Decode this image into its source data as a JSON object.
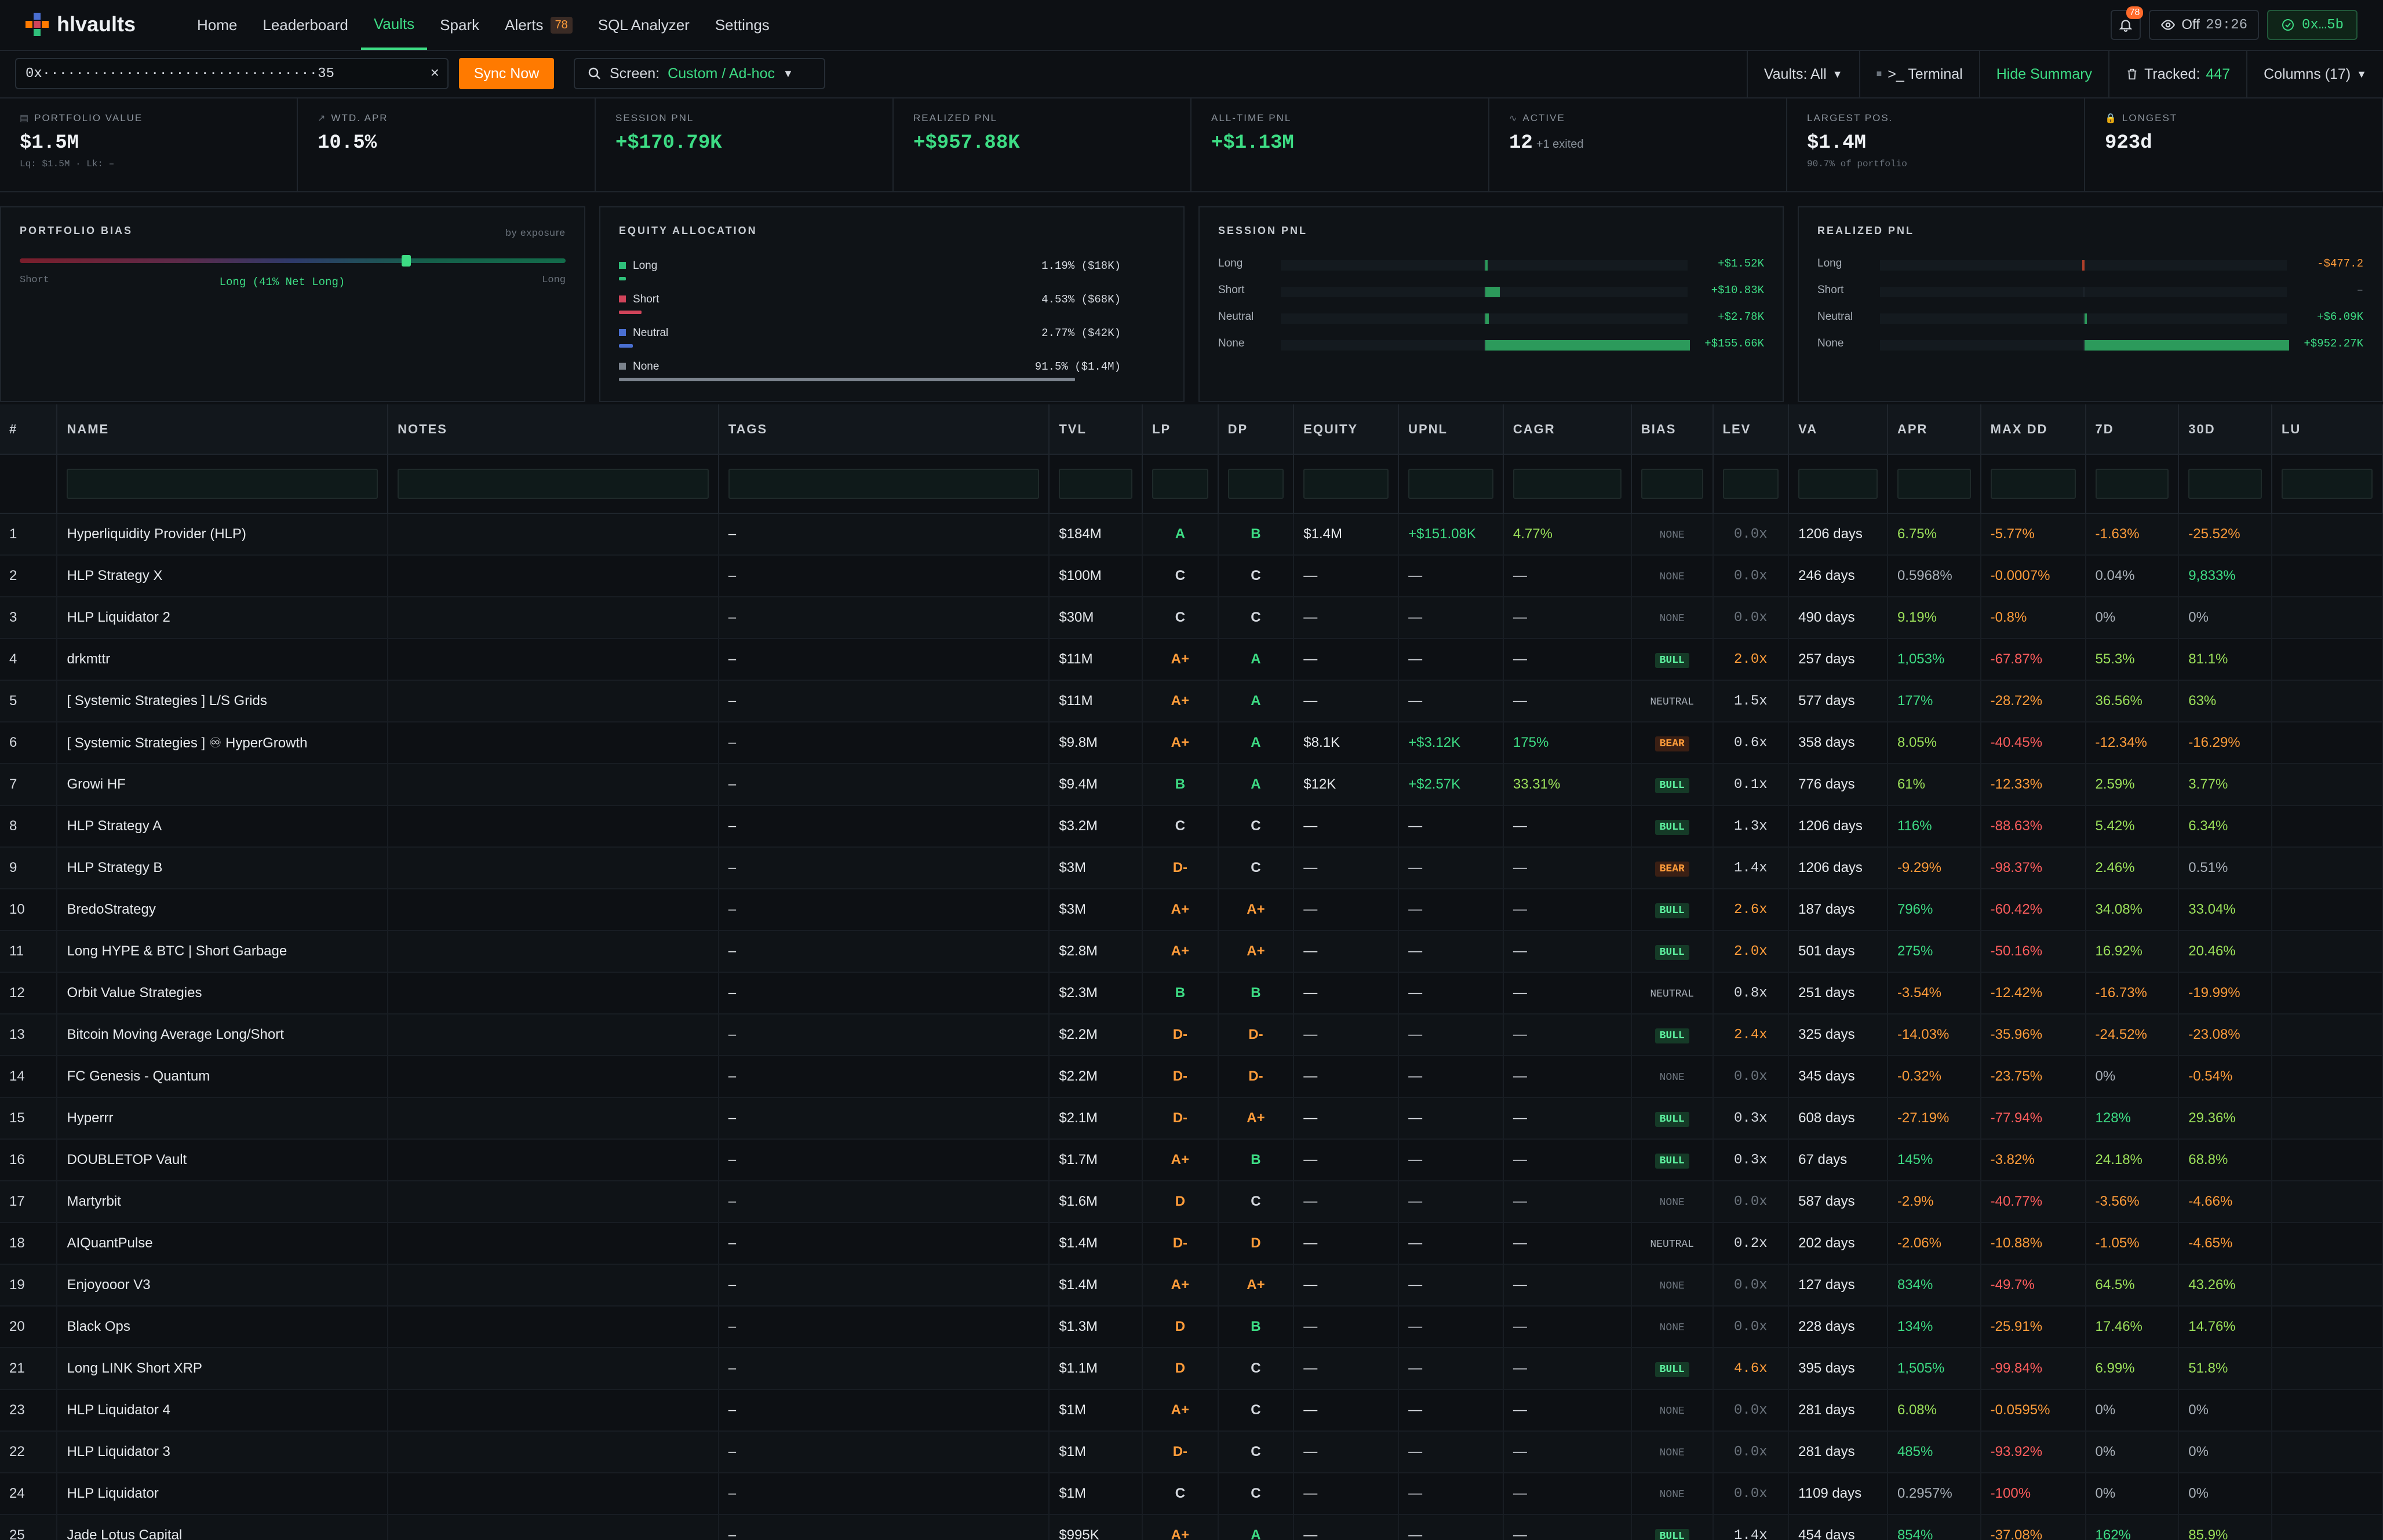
{
  "app": {
    "name": "hlvaults"
  },
  "nav": [
    {
      "label": "Home",
      "active": false
    },
    {
      "label": "Leaderboard",
      "active": false
    },
    {
      "label": "Vaults",
      "active": true
    },
    {
      "label": "Spark",
      "active": false
    },
    {
      "label": "Alerts",
      "active": false,
      "badge": "78"
    },
    {
      "label": "SQL Analyzer",
      "active": false
    },
    {
      "label": "Settings",
      "active": false
    }
  ],
  "topRight": {
    "bell_badge": "78",
    "live_status": "Off",
    "timer": "29:26",
    "wallet": "0x…5b"
  },
  "toolbar": {
    "address_value": "0x·································35",
    "clear": "×",
    "sync_label": "Sync Now",
    "screen_label": "Screen:",
    "screen_value": "Custom / Ad-hoc",
    "vaults_label": "Vaults: All",
    "terminal_label": ">_ Terminal",
    "hide_summary_label": "Hide Summary",
    "tracked_label": "Tracked:",
    "tracked_value": "447",
    "columns_label": "Columns (17)"
  },
  "summary": [
    {
      "label": "PORTFOLIO VALUE",
      "value": "$1.5M",
      "sub": "Lq: $1.5M · Lk: –",
      "color": "#eef1f4"
    },
    {
      "label": "WTD. APR",
      "value": "10.5%",
      "sub": "",
      "color": "#eef1f4"
    },
    {
      "label": "SESSION PNL",
      "value": "+$170.79K",
      "sub": "",
      "color": "#3ddc84"
    },
    {
      "label": "REALIZED PNL",
      "value": "+$957.88K",
      "sub": "",
      "color": "#3ddc84"
    },
    {
      "label": "ALL-TIME PNL",
      "value": "+$1.13M",
      "sub": "",
      "color": "#3ddc84"
    },
    {
      "label": "ACTIVE",
      "value": "12",
      "extra": "+1 exited",
      "sub": "",
      "color": "#eef1f4"
    },
    {
      "label": "LARGEST POS.",
      "value": "$1.4M",
      "sub": "90.7% of portfolio",
      "color": "#eef1f4"
    },
    {
      "label": "LONGEST",
      "value": "923d",
      "sub": "",
      "color": "#eef1f4"
    }
  ],
  "bias": {
    "title": "PORTFOLIO BIAS",
    "sub": "by exposure",
    "left": "Short",
    "right": "Long",
    "center": "Long (41% Net Long)",
    "position": 0.705
  },
  "allocation": {
    "title": "EQUITY ALLOCATION",
    "rows": [
      {
        "name": "Long",
        "value": "1.19% ($18K)",
        "color": "#2fbf7a",
        "fraction": 0.0119
      },
      {
        "name": "Short",
        "value": "4.53% ($68K)",
        "color": "#d0445a",
        "fraction": 0.0453
      },
      {
        "name": "Neutral",
        "value": "2.77% ($42K)",
        "color": "#4a6fd1",
        "fraction": 0.0277
      },
      {
        "name": "None",
        "value": "91.5% ($1.4M)",
        "color": "#7b838d",
        "fraction": 0.915
      }
    ]
  },
  "sessionPnl": {
    "title": "SESSION PNL",
    "rows": [
      {
        "name": "Long",
        "value": "+$1.52K",
        "amount": 1520
      },
      {
        "name": "Short",
        "value": "+$10.83K",
        "amount": 10830
      },
      {
        "name": "Neutral",
        "value": "+$2.78K",
        "amount": 2780
      },
      {
        "name": "None",
        "value": "+$155.66K",
        "amount": 155660
      }
    ]
  },
  "realizedPnl": {
    "title": "REALIZED PNL",
    "rows": [
      {
        "name": "Long",
        "value": "-$477.2",
        "amount": -477.2
      },
      {
        "name": "Short",
        "value": "–",
        "amount": 0
      },
      {
        "name": "Neutral",
        "value": "+$6.09K",
        "amount": 6090
      },
      {
        "name": "None",
        "value": "+$952.27K",
        "amount": 952270
      }
    ]
  },
  "table": {
    "columns": [
      "#",
      "NAME",
      "NOTES",
      "TAGS",
      "TVL",
      "LP",
      "DP",
      "EQUITY",
      "UPNL",
      "CAGR",
      "BIAS",
      "LEV",
      "VA",
      "APR",
      "MAX DD",
      "7D",
      "30D",
      "LU"
    ],
    "rows": [
      [
        "1",
        "Hyperliquidity Provider (HLP)",
        "",
        "–",
        "$184M",
        "A",
        "B",
        "$1.4M",
        "+$151.08K",
        "4.77%",
        "NONE",
        "0.0x",
        "1206 days",
        "6.75%",
        "-5.77%",
        "-1.63%",
        "-25.52%",
        ""
      ],
      [
        "2",
        "HLP Strategy X",
        "",
        "–",
        "$100M",
        "C",
        "C",
        "—",
        "—",
        "—",
        "NONE",
        "0.0x",
        "246 days",
        "0.5968%",
        "-0.0007%",
        "0.04%",
        "9,833%",
        ""
      ],
      [
        "3",
        "HLP Liquidator 2",
        "",
        "–",
        "$30M",
        "C",
        "C",
        "—",
        "—",
        "—",
        "NONE",
        "0.0x",
        "490 days",
        "9.19%",
        "-0.8%",
        "0%",
        "0%",
        ""
      ],
      [
        "4",
        "drkmttr",
        "",
        "–",
        "$11M",
        "A+",
        "A",
        "—",
        "—",
        "—",
        "BULL",
        "2.0x",
        "257 days",
        "1,053%",
        "-67.87%",
        "55.3%",
        "81.1%",
        ""
      ],
      [
        "5",
        "[ Systemic Strategies ] L/S Grids",
        "",
        "–",
        "$11M",
        "A+",
        "A",
        "—",
        "—",
        "—",
        "NEUTRAL",
        "1.5x",
        "577 days",
        "177%",
        "-28.72%",
        "36.56%",
        "63%",
        ""
      ],
      [
        "6",
        "[ Systemic Strategies ] ♾ HyperGrowth",
        "",
        "–",
        "$9.8M",
        "A+",
        "A",
        "$8.1K",
        "+$3.12K",
        "175%",
        "BEAR",
        "0.6x",
        "358 days",
        "8.05%",
        "-40.45%",
        "-12.34%",
        "-16.29%",
        ""
      ],
      [
        "7",
        "Growi HF",
        "",
        "–",
        "$9.4M",
        "B",
        "A",
        "$12K",
        "+$2.57K",
        "33.31%",
        "BULL",
        "0.1x",
        "776 days",
        "61%",
        "-12.33%",
        "2.59%",
        "3.77%",
        ""
      ],
      [
        "8",
        "HLP Strategy A",
        "",
        "–",
        "$3.2M",
        "C",
        "C",
        "—",
        "—",
        "—",
        "BULL",
        "1.3x",
        "1206 days",
        "116%",
        "-88.63%",
        "5.42%",
        "6.34%",
        ""
      ],
      [
        "9",
        "HLP Strategy B",
        "",
        "–",
        "$3M",
        "D-",
        "C",
        "—",
        "—",
        "—",
        "BEAR",
        "1.4x",
        "1206 days",
        "-9.29%",
        "-98.37%",
        "2.46%",
        "0.51%",
        ""
      ],
      [
        "10",
        "BredoStrategy",
        "",
        "–",
        "$3M",
        "A+",
        "A+",
        "—",
        "—",
        "—",
        "BULL",
        "2.6x",
        "187 days",
        "796%",
        "-60.42%",
        "34.08%",
        "33.04%",
        ""
      ],
      [
        "11",
        "Long HYPE & BTC | Short Garbage",
        "",
        "–",
        "$2.8M",
        "A+",
        "A+",
        "—",
        "—",
        "—",
        "BULL",
        "2.0x",
        "501 days",
        "275%",
        "-50.16%",
        "16.92%",
        "20.46%",
        ""
      ],
      [
        "12",
        "Orbit Value Strategies",
        "",
        "–",
        "$2.3M",
        "B",
        "B",
        "—",
        "—",
        "—",
        "NEUTRAL",
        "0.8x",
        "251 days",
        "-3.54%",
        "-12.42%",
        "-16.73%",
        "-19.99%",
        ""
      ],
      [
        "13",
        "Bitcoin Moving Average Long/Short",
        "",
        "–",
        "$2.2M",
        "D-",
        "D-",
        "—",
        "—",
        "—",
        "BULL",
        "2.4x",
        "325 days",
        "-14.03%",
        "-35.96%",
        "-24.52%",
        "-23.08%",
        ""
      ],
      [
        "14",
        "FC Genesis - Quantum",
        "",
        "–",
        "$2.2M",
        "D-",
        "D-",
        "—",
        "—",
        "—",
        "NONE",
        "0.0x",
        "345 days",
        "-0.32%",
        "-23.75%",
        "0%",
        "-0.54%",
        ""
      ],
      [
        "15",
        "Hyperrr",
        "",
        "–",
        "$2.1M",
        "D-",
        "A+",
        "—",
        "—",
        "—",
        "BULL",
        "0.3x",
        "608 days",
        "-27.19%",
        "-77.94%",
        "128%",
        "29.36%",
        ""
      ],
      [
        "16",
        "DOUBLETOP Vault",
        "",
        "–",
        "$1.7M",
        "A+",
        "B",
        "—",
        "—",
        "—",
        "BULL",
        "0.3x",
        "67 days",
        "145%",
        "-3.82%",
        "24.18%",
        "68.8%",
        ""
      ],
      [
        "17",
        "Martyrbit",
        "",
        "–",
        "$1.6M",
        "D",
        "C",
        "—",
        "—",
        "—",
        "NONE",
        "0.0x",
        "587 days",
        "-2.9%",
        "-40.77%",
        "-3.56%",
        "-4.66%",
        ""
      ],
      [
        "18",
        "AIQuantPulse",
        "",
        "–",
        "$1.4M",
        "D-",
        "D",
        "—",
        "—",
        "—",
        "NEUTRAL",
        "0.2x",
        "202 days",
        "-2.06%",
        "-10.88%",
        "-1.05%",
        "-4.65%",
        ""
      ],
      [
        "19",
        "Enjoyooor V3",
        "",
        "–",
        "$1.4M",
        "A+",
        "A+",
        "—",
        "—",
        "—",
        "NONE",
        "0.0x",
        "127 days",
        "834%",
        "-49.7%",
        "64.5%",
        "43.26%",
        ""
      ],
      [
        "20",
        "Black Ops",
        "",
        "–",
        "$1.3M",
        "D",
        "B",
        "—",
        "—",
        "—",
        "NONE",
        "0.0x",
        "228 days",
        "134%",
        "-25.91%",
        "17.46%",
        "14.76%",
        ""
      ],
      [
        "21",
        "Long LINK Short XRP",
        "",
        "–",
        "$1.1M",
        "D",
        "C",
        "—",
        "—",
        "—",
        "BULL",
        "4.6x",
        "395 days",
        "1,505%",
        "-99.84%",
        "6.99%",
        "51.8%",
        ""
      ],
      [
        "23",
        "HLP Liquidator 4",
        "",
        "–",
        "$1M",
        "A+",
        "C",
        "—",
        "—",
        "—",
        "NONE",
        "0.0x",
        "281 days",
        "6.08%",
        "-0.0595%",
        "0%",
        "0%",
        ""
      ],
      [
        "22",
        "HLP Liquidator 3",
        "",
        "–",
        "$1M",
        "D-",
        "C",
        "—",
        "—",
        "—",
        "NONE",
        "0.0x",
        "281 days",
        "485%",
        "-93.92%",
        "0%",
        "0%",
        ""
      ],
      [
        "24",
        "HLP Liquidator",
        "",
        "–",
        "$1M",
        "C",
        "C",
        "—",
        "—",
        "—",
        "NONE",
        "0.0x",
        "1109 days",
        "0.2957%",
        "-100%",
        "0%",
        "0%",
        ""
      ],
      [
        "25",
        "Jade Lotus Capital",
        "",
        "–",
        "$995K",
        "A+",
        "A",
        "—",
        "—",
        "—",
        "BULL",
        "1.4x",
        "454 days",
        "854%",
        "-37.08%",
        "162%",
        "85.9%",
        ""
      ]
    ]
  }
}
